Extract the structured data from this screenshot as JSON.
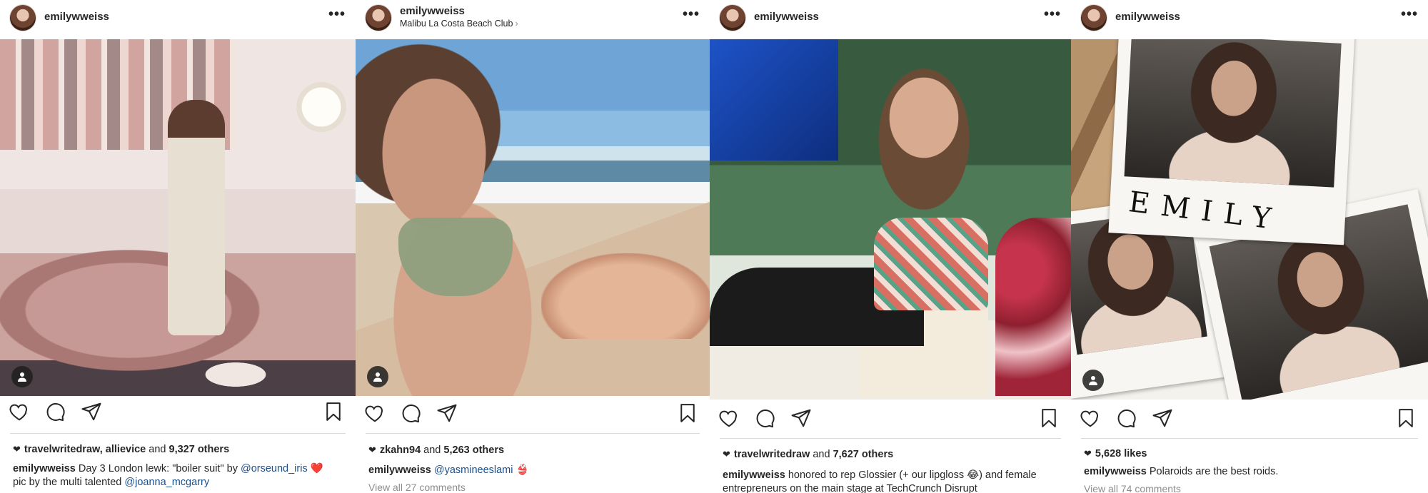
{
  "posts": [
    {
      "username": "emilywweiss",
      "location": "",
      "more_label": "•••",
      "liked_by": "travelwritedraw, allievice",
      "likes_connector": "and",
      "likes_others": "9,327 others",
      "caption": {
        "user": "emilywweiss",
        "text_1": "Day 3 London lewk: \"boiler suit\" by",
        "mention_1": "@orseund_iris",
        "emoji": "❤️",
        "text_2": "pic by the multi talented",
        "mention_2": "@joanna_mcgarry"
      },
      "view_comments": ""
    },
    {
      "username": "emilywweiss",
      "location": "Malibu La Costa Beach Club",
      "location_chevron": "›",
      "more_label": "•••",
      "liked_by": "zkahn94",
      "likes_connector": "and",
      "likes_others": "5,263 others",
      "caption": {
        "user": "emilywweiss",
        "mention_1": "@yasmineeslami",
        "emoji": "👙"
      },
      "view_comments": "View all 27 comments"
    },
    {
      "username": "emilywweiss",
      "location": "",
      "more_label": "•••",
      "liked_by": "travelwritedraw",
      "likes_connector": "and",
      "likes_others": "7,627 others",
      "caption": {
        "user": "emilywweiss",
        "text_1": "honored to rep Glossier (+ our lipgloss",
        "emoji": "😂",
        "text_2": ") and female entrepreneurs on the main stage at TechCrunch Disrupt"
      },
      "view_comments": ""
    },
    {
      "username": "emilywweiss",
      "location": "",
      "more_label": "•••",
      "likes_count": "5,628 likes",
      "caption": {
        "user": "emilywweiss",
        "text_1": "Polaroids are the best roids."
      },
      "polaroid_text": "EMILY",
      "view_comments": "View all 74 comments"
    }
  ],
  "icons": {
    "like": "heart-outline-icon",
    "comment": "speech-bubble-icon",
    "share": "paper-plane-icon",
    "save": "bookmark-icon",
    "user_tag": "person-icon",
    "liked_heart": "heart-filled-icon"
  },
  "colors": {
    "text": "#262626",
    "mention": "#1b4f8a",
    "muted": "#8e8e8e",
    "divider": "#dbdbdb"
  }
}
